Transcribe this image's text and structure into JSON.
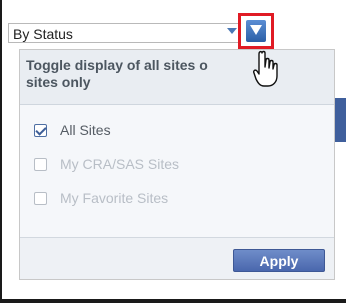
{
  "status_select": {
    "value": "By Status"
  },
  "filter_button": {
    "icon": "filter-icon",
    "highlight_color": "#e01b24"
  },
  "popup": {
    "tooltip": "Toggle display of all sites or my sites only",
    "tooltip_visible_lines": [
      "Toggle display of all sites o",
      "sites only"
    ],
    "options": [
      {
        "label": "All Sites",
        "checked": true,
        "enabled": true
      },
      {
        "label": "My CRA/SAS Sites",
        "checked": false,
        "enabled": false
      },
      {
        "label": "My Favorite Sites",
        "checked": false,
        "enabled": false
      }
    ],
    "apply_label": "Apply"
  },
  "colors": {
    "accent": "#4a67ad",
    "border_highlight": "#e01b24"
  }
}
